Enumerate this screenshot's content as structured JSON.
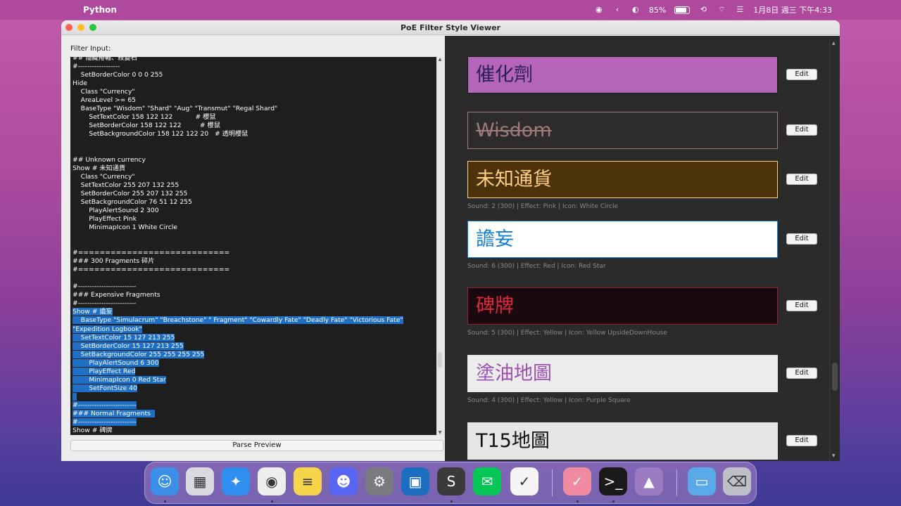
{
  "menubar": {
    "app_name": "Python",
    "battery_pct": "85%",
    "datetime": "1月8日 週三 下午4:33"
  },
  "window": {
    "title": "PoE Filter Style Viewer"
  },
  "left": {
    "filter_label": "Filter Input:",
    "parse_button": "Parse  Preview",
    "code_lines": [
      {
        "text": "## 隱藏捲軸、殺變石",
        "sel": false
      },
      {
        "text": "#------------------",
        "sel": false
      },
      {
        "text": "    SetBorderColor 0 0 0 255",
        "sel": false
      },
      {
        "text": "Hide",
        "sel": false
      },
      {
        "text": "    Class \"Currency\"",
        "sel": false
      },
      {
        "text": "    AreaLevel >= 65",
        "sel": false
      },
      {
        "text": "    BaseType \"Wisdom\" \"Shard\" \"Aug\" \"Transmut\" \"Regal Shard\"",
        "sel": false
      },
      {
        "text": "        SetTextColor 158 122 122           # 櫻鼠",
        "sel": false
      },
      {
        "text": "        SetBorderColor 158 122 122         # 櫻鼠",
        "sel": false
      },
      {
        "text": "        SetBackgroundColor 158 122 122 20   # 透明櫻鼠",
        "sel": false
      },
      {
        "text": "",
        "sel": false
      },
      {
        "text": "",
        "sel": false
      },
      {
        "text": "## Unknown currency",
        "sel": false
      },
      {
        "text": "Show # 未知通貨",
        "sel": false
      },
      {
        "text": "    Class \"Currency\"",
        "sel": false
      },
      {
        "text": "    SetTextColor 255 207 132 255",
        "sel": false
      },
      {
        "text": "    SetBorderColor 255 207 132 255",
        "sel": false
      },
      {
        "text": "    SetBackgroundColor 76 51 12 255",
        "sel": false
      },
      {
        "text": "        PlayAlertSound 2 300",
        "sel": false
      },
      {
        "text": "        PlayEffect Pink",
        "sel": false
      },
      {
        "text": "        MinimapIcon 1 White Circle",
        "sel": false
      },
      {
        "text": "",
        "sel": false
      },
      {
        "text": "",
        "sel": false
      },
      {
        "text": "#============================",
        "sel": false
      },
      {
        "text": "### 300 Fragments 碎片",
        "sel": false
      },
      {
        "text": "#============================",
        "sel": false
      },
      {
        "text": "",
        "sel": false
      },
      {
        "text": "#-------------------------",
        "sel": false
      },
      {
        "text": "### Expensive Fragments",
        "sel": false
      },
      {
        "text": "#-------------------------",
        "sel": false
      },
      {
        "text": "Show # 譫妄",
        "sel": true
      },
      {
        "text": "    BaseType \"Simulacrum\" \"Breachstone\" \" Fragment\" \"Cowardly Fate\" \"Deadly Fate\" \"Victorious Fate\"",
        "sel": true
      },
      {
        "text": "\"Expedition Logbook\"",
        "sel": true
      },
      {
        "text": "    SetTextColor 15 127 213 255",
        "sel": true
      },
      {
        "text": "    SetBorderColor 15 127 213 255",
        "sel": true
      },
      {
        "text": "    SetBackgroundColor 255 255 255 255",
        "sel": true
      },
      {
        "text": "        PlayAlertSound 6 300",
        "sel": true
      },
      {
        "text": "        PlayEffect Red",
        "sel": true
      },
      {
        "text": "        MinimapIcon 0 Red Star",
        "sel": true
      },
      {
        "text": "        SetFontSize 40",
        "sel": true
      },
      {
        "text": "  ",
        "sel": true
      },
      {
        "text": "#-------------------------",
        "sel": true
      },
      {
        "text": "### Normal Fragments  ",
        "sel": true
      },
      {
        "text": "#-------------------------",
        "sel": true
      },
      {
        "text": "Show # 碑牌",
        "sel": false
      }
    ]
  },
  "right": {
    "edit_label": "Edit",
    "items": [
      {
        "text": "催化劑",
        "color": "#2a1f5a",
        "bg": "#b565b8",
        "border": "#1a1a1a",
        "strike": false,
        "info": ""
      },
      {
        "text": "Wisdom",
        "color": "#9e7a7a",
        "bg": "#2e2b2b",
        "border": "#9e7a7a",
        "strike": true,
        "info": ""
      },
      {
        "text": "未知通貨",
        "color": "#ffcf84",
        "bg": "#4c330c",
        "border": "#ffcf84",
        "strike": false,
        "info": "Sound: 2 (300) | Effect: Pink | Icon: White Circle"
      },
      {
        "text": "譫妄",
        "color": "#0f7fd5",
        "bg": "#ffffff",
        "border": "#0f7fd5",
        "strike": false,
        "info": "Sound: 6 (300) | Effect: Red | Icon: Red Star"
      },
      {
        "text": "碑牌",
        "color": "#e0283c",
        "bg": "#1a0a10",
        "border": "#a01e32",
        "strike": false,
        "info": "Sound: 5 (300) | Effect: Yellow | Icon: Yellow UpsideDownHouse"
      },
      {
        "text": "塗油地圖",
        "color": "#9b4fb0",
        "bg": "#ececec",
        "border": "#ececec",
        "strike": false,
        "info": "Sound: 4 (300) | Effect: Yellow | Icon: Purple Square"
      },
      {
        "text": "T15地圖",
        "color": "#111111",
        "bg": "#e6e6e6",
        "border": "#e6e6e6",
        "strike": false,
        "info": ""
      }
    ]
  },
  "dock": {
    "apps": [
      {
        "name": "finder-icon",
        "bg": "#3b8fe6",
        "glyph": "☺"
      },
      {
        "name": "launchpad-icon",
        "bg": "#d9d9e0",
        "glyph": "▦"
      },
      {
        "name": "safari-icon",
        "bg": "#2f8ef0",
        "glyph": "✦"
      },
      {
        "name": "chrome-icon",
        "bg": "#eeeeee",
        "glyph": "◉"
      },
      {
        "name": "notes-icon",
        "bg": "#f7d54a",
        "glyph": "≡"
      },
      {
        "name": "discord-icon",
        "bg": "#5865f2",
        "glyph": "☻"
      },
      {
        "name": "system-settings-icon",
        "bg": "#7a7a80",
        "glyph": "⚙"
      },
      {
        "name": "screen-sharing-icon",
        "bg": "#1c6fc0",
        "glyph": "▣"
      },
      {
        "name": "sublime-text-icon",
        "bg": "#3a3a3a",
        "glyph": "S"
      },
      {
        "name": "line-icon",
        "bg": "#06c755",
        "glyph": "✉"
      },
      {
        "name": "ticktick-icon",
        "bg": "#f5f5f5",
        "glyph": "✓"
      },
      {
        "name": "focus-app-icon",
        "bg": "#f08aa0",
        "glyph": "✓"
      },
      {
        "name": "terminal-icon",
        "bg": "#1a1a1a",
        "glyph": ">_"
      },
      {
        "name": "rocket-icon",
        "bg": "#9a7ac0",
        "glyph": "▲"
      },
      {
        "name": "folder-icon",
        "bg": "#5aa9e8",
        "glyph": "▭"
      },
      {
        "name": "trash-icon",
        "bg": "#bfbfc8",
        "glyph": "⌫"
      }
    ]
  }
}
